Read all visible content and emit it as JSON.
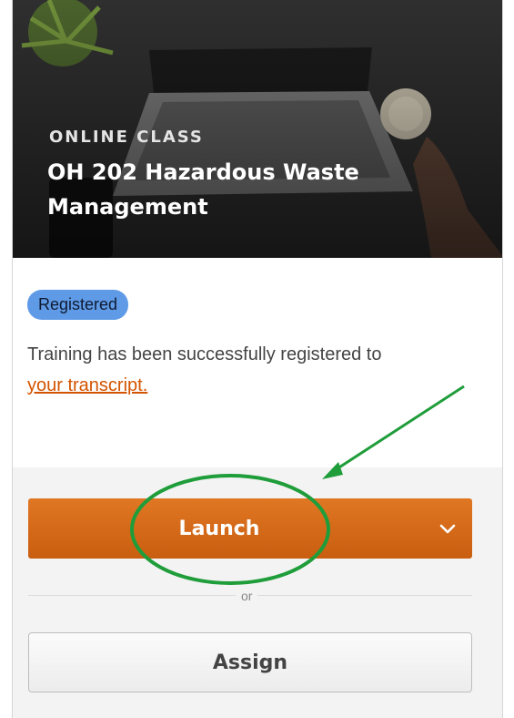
{
  "course": {
    "type_label": "ONLINE CLASS",
    "title": "OH 202 Hazardous Waste Management"
  },
  "status": {
    "badge": "Registered",
    "message": "Training has been successfully registered to",
    "link_text": "your transcript."
  },
  "actions": {
    "launch_label": "Launch",
    "separator": "or",
    "assign_label": "Assign"
  },
  "colors": {
    "badge": "#5f9ae6",
    "launch_button": "#d86a18",
    "link": "#d35400",
    "annotation": "#1f9d3a"
  },
  "icons": {
    "launch_menu": "chevron-down-icon"
  }
}
